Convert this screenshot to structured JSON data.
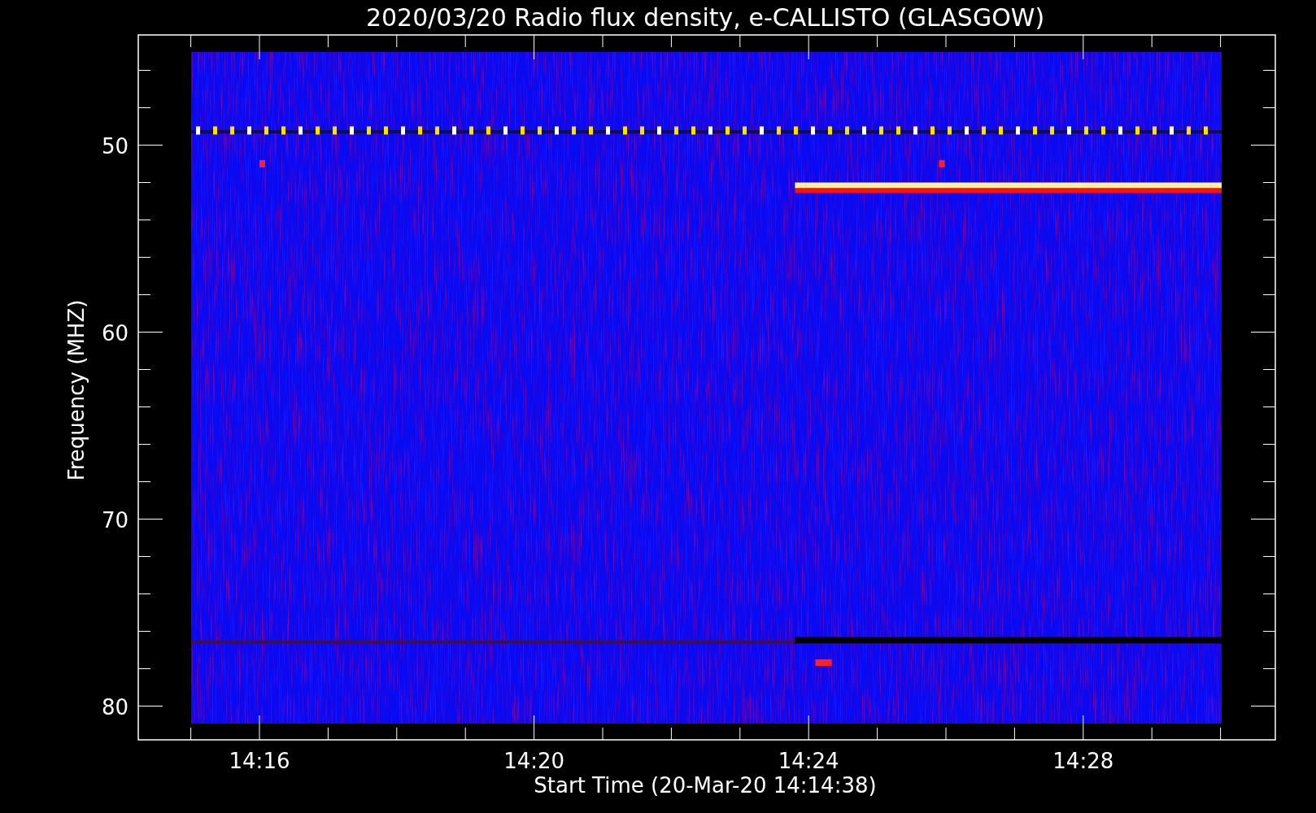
{
  "title": "2020/03/20  Radio flux density, e-CALLISTO (GLASGOW)",
  "xlabel": "Start Time (20-Mar-20 14:14:38)",
  "ylabel": "Frequency (MHZ)",
  "xticks": [
    {
      "label": "14:16"
    },
    {
      "label": "14:20"
    },
    {
      "label": "14:24"
    },
    {
      "label": "14:28"
    }
  ],
  "yticks": [
    {
      "label": "50"
    },
    {
      "label": "60"
    },
    {
      "label": "70"
    },
    {
      "label": "80"
    }
  ]
}
